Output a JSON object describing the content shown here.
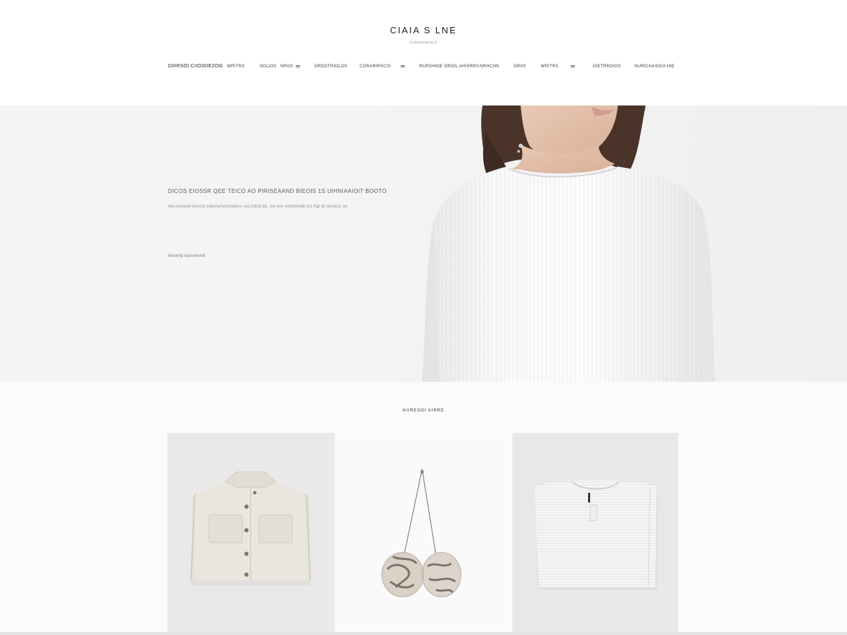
{
  "header": {
    "brand": "CIAIA S LNE",
    "tagline": "CIDOGHAYA P"
  },
  "nav": {
    "items": [
      "DIIIRSOI CIIOIDIEZOG",
      "WRITRS",
      "SOLIOS",
      "NRIOI",
      "DRDOTRIOLOS",
      "CORARIRSCIS",
      "RURSHIDE ORIOL AHISRRS",
      "NRHCHN",
      "DRIIS",
      "WRITRS",
      "DIETRROIOS",
      "NURICHASOIA HIE"
    ]
  },
  "hero": {
    "headline": "DICOS EIOSSR QEE TEICO AO PIRISEAAND BIEOIS    1S UIHNIAAIOIT BOOTO",
    "subheading": "Ale mresed enrvsd sdiiony/smriodens ooj rslisd tjk, Ive ere ommdnide ticl Aqr di smuesc un",
    "cta": "deuerig eqsuiesedi"
  },
  "collection": {
    "title": "NIIRESOI AIRRE",
    "products": [
      {
        "name": "utility-vest",
        "image": "folded-cream-vest"
      },
      {
        "name": "pendant-earrings",
        "image": "marbled-stone-earrings"
      },
      {
        "name": "knit-top",
        "image": "white-ribbed-knit-top"
      }
    ]
  },
  "colors": {
    "background": "#ffffff",
    "hero_background": "#f3f3f3",
    "text_primary": "#1c1c1c",
    "text_muted": "#8c8c8c"
  }
}
